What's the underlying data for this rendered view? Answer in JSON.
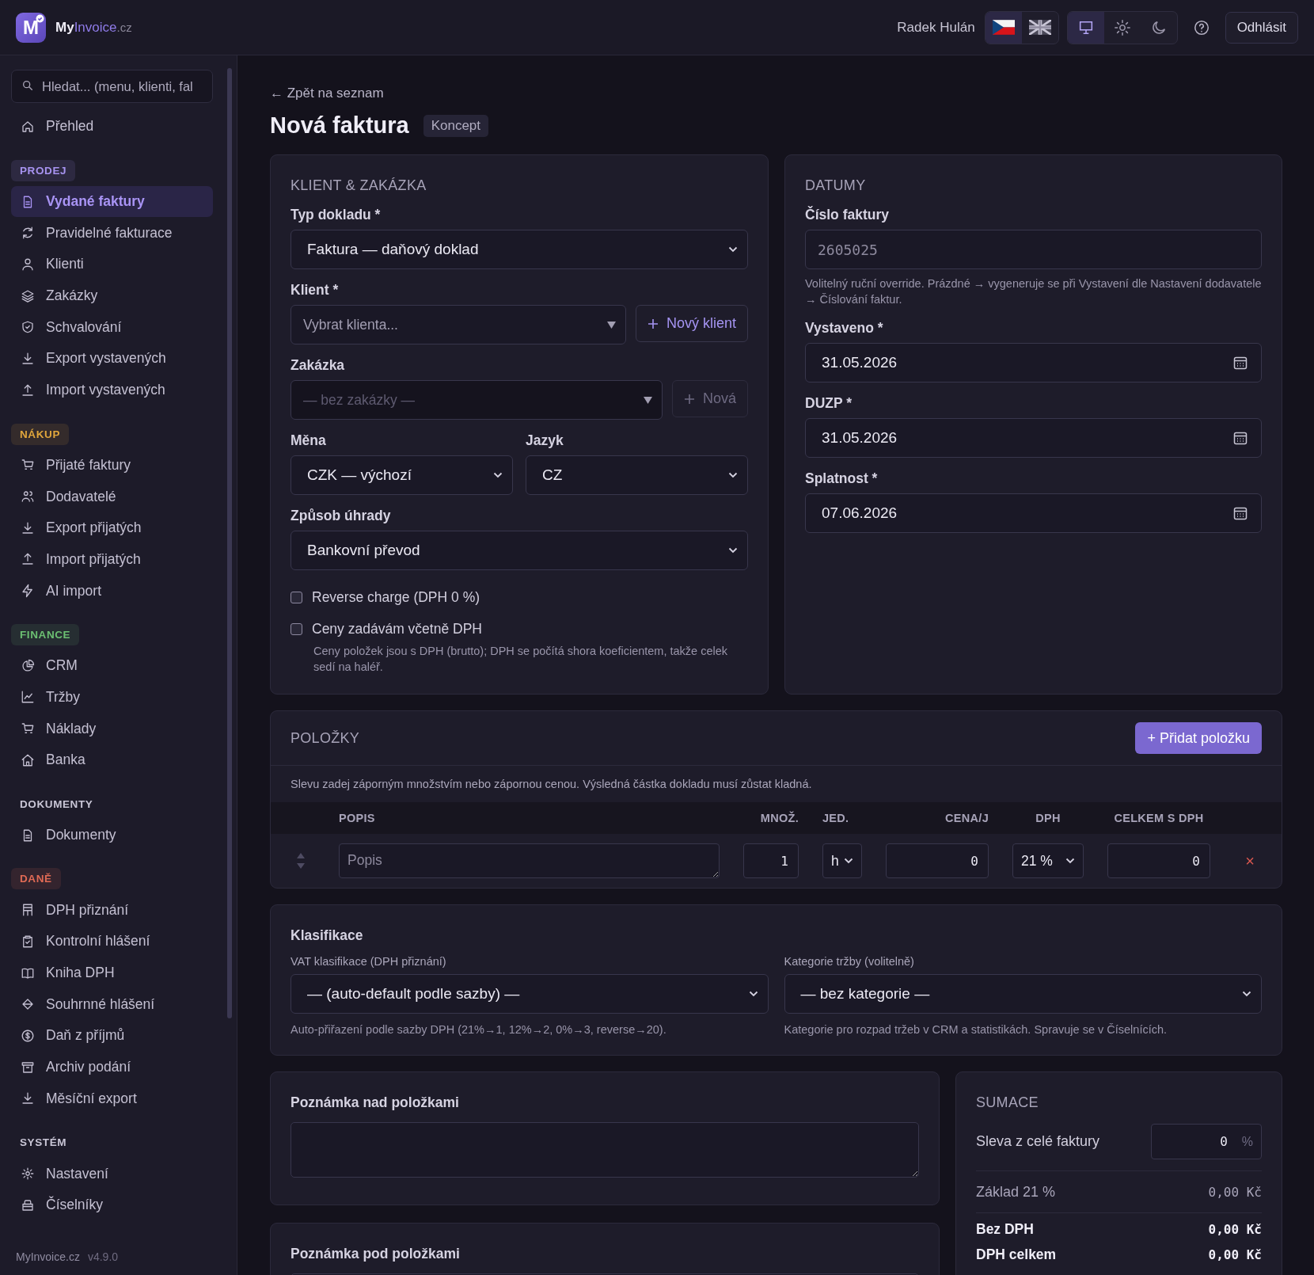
{
  "header": {
    "logo_letter": "M",
    "brand": [
      {
        "text": "My",
        "kind": "bold"
      },
      {
        "text": "Invoice",
        "kind": "accent"
      },
      {
        "text": ".cz",
        "kind": "muted"
      }
    ],
    "user": "Radek Hulán",
    "languages": [
      {
        "selected": true
      },
      {
        "selected": false
      }
    ],
    "themes": [
      {
        "selected": true
      },
      {
        "selected": false
      },
      {
        "selected": false
      }
    ],
    "logout": "Odhlásit"
  },
  "sidebar": {
    "search_placeholder": "Hledat... (menu, klienti, fal",
    "top_items": [
      {
        "label": "Přehled",
        "selected": false
      }
    ],
    "groups": [
      {
        "heading": "PRODEJ",
        "color": "#a793f0",
        "items": [
          {
            "label": "Vydané faktury",
            "selected": true
          },
          {
            "label": "Pravidelné fakturace",
            "selected": false
          },
          {
            "label": "Klienti",
            "selected": false
          },
          {
            "label": "Zakázky",
            "selected": false
          },
          {
            "label": "Schvalování",
            "selected": false
          },
          {
            "label": "Export vystavených",
            "selected": false
          },
          {
            "label": "Import vystavených",
            "selected": false
          }
        ]
      },
      {
        "heading": "NÁKUP",
        "color": "#e0a63c",
        "items": [
          {
            "label": "Přijaté faktury",
            "selected": false
          },
          {
            "label": "Dodavatelé",
            "selected": false
          },
          {
            "label": "Export přijatých",
            "selected": false
          },
          {
            "label": "Import přijatých",
            "selected": false
          },
          {
            "label": "AI import",
            "selected": false
          }
        ]
      },
      {
        "heading": "FINANCE",
        "color": "#6cbf72",
        "items": [
          {
            "label": "CRM",
            "selected": false
          },
          {
            "label": "Tržby",
            "selected": false
          },
          {
            "label": "Náklady",
            "selected": false
          },
          {
            "label": "Banka",
            "selected": false
          }
        ]
      },
      {
        "heading": "DOKUMENTY",
        "items": [
          {
            "label": "Dokumenty",
            "selected": false
          }
        ]
      },
      {
        "heading": "DANĚ",
        "color": "#e06a55",
        "items": [
          {
            "label": "DPH přiznání",
            "selected": false
          },
          {
            "label": "Kontrolní hlášení",
            "selected": false
          },
          {
            "label": "Kniha DPH",
            "selected": false
          },
          {
            "label": "Souhrnné hlášení",
            "selected": false
          },
          {
            "label": "Daň z příjmů",
            "selected": false
          },
          {
            "label": "Archiv podání",
            "selected": false
          },
          {
            "label": "Měsíční export",
            "selected": false
          }
        ]
      },
      {
        "heading": "SYSTÉM",
        "items": [
          {
            "label": "Nastavení",
            "selected": false
          },
          {
            "label": "Číselníky",
            "selected": false
          }
        ]
      }
    ],
    "footer": {
      "name": "MyInvoice.cz",
      "version": "v4.9.0"
    }
  },
  "back_link": "← Zpět na seznam",
  "title": "Nová faktura",
  "status_badge": "Koncept",
  "client_card": {
    "heading": "KLIENT & ZAKÁZKA",
    "document_type": {
      "label": "Typ dokladu *",
      "value": "Faktura — daňový doklad"
    },
    "client": {
      "label": "Klient *",
      "placeholder": "Vybrat klienta...",
      "button": "Nový klient",
      "disabled": false
    },
    "project": {
      "label": "Zakázka",
      "placeholder": "— bez zakázky —",
      "button": "Nová",
      "disabled": true
    },
    "currency": {
      "label": "Měna",
      "value": "CZK — výchozí"
    },
    "language": {
      "label": "Jazyk",
      "value": "CZ"
    },
    "payment": {
      "label": "Způsob úhrady",
      "value": "Bankovní převod"
    },
    "checkboxes": [
      {
        "label": "Reverse charge (DPH 0 %)",
        "checked": false
      },
      {
        "label": "Ceny zadávám včetně DPH",
        "checked": false,
        "hint": "Ceny položek jsou s DPH (brutto); DPH se počítá shora koeficientem, takže celek sedí na haléř."
      }
    ]
  },
  "dates_card": {
    "heading": "DATUMY",
    "invoice_number": {
      "label": "Číslo faktury",
      "placeholder": "2605025",
      "hint": "Volitelný ruční override. Prázdné → vygeneruje se při Vystavení dle Nastavení dodavatele → Číslování faktur."
    },
    "dates": [
      {
        "label": "Vystaveno *",
        "value": "31.05.2026"
      },
      {
        "label": "DUZP *",
        "value": "31.05.2026"
      },
      {
        "label": "Splatnost *",
        "value": "07.06.2026"
      }
    ]
  },
  "items_card": {
    "heading": "POLOŽKY",
    "add_button": "+ Přidat položku",
    "note": "Slevu zadej záporným množstvím nebo zápornou cenou. Výsledná částka dokladu musí zůstat kladná.",
    "columns": [
      "POPIS",
      "MNOŽ.",
      "JED.",
      "CENA/J",
      "DPH",
      "CELKEM S DPH"
    ],
    "rows": [
      {
        "description_placeholder": "Popis",
        "quantity": "1",
        "unit": "h",
        "price": "0",
        "vat": "21 %",
        "total": "0",
        "remove": "×"
      }
    ]
  },
  "classification_card": {
    "heading": "Klasifikace",
    "fields": [
      {
        "label": "VAT klasifikace (DPH přiznání)",
        "value": "— (auto-default podle sazby) —",
        "hint": "Auto-přiřazení podle sazby DPH (21%→1, 12%→2, 0%→3, reverse→20)."
      },
      {
        "label": "Kategorie tržby (volitelně)",
        "value": "— bez kategorie —",
        "hint": "Kategorie pro rozpad tržeb v CRM a statistikách. Spravuje se v Číselnících."
      }
    ]
  },
  "notes": [
    {
      "label": "Poznámka nad položkami"
    },
    {
      "label": "Poznámka pod položkami"
    }
  ],
  "summary": {
    "heading": "SUMACE",
    "discount": {
      "label": "Sleva z celé faktury",
      "value": "0",
      "unit": "%"
    },
    "lines": [
      {
        "label": "Základ 21 %",
        "value": "0,00 Kč",
        "kind": "base"
      },
      {
        "label": "Bez DPH",
        "value": "0,00 Kč",
        "kind": "total"
      },
      {
        "label": "DPH celkem",
        "value": "0,00 Kč",
        "kind": "total"
      }
    ]
  }
}
